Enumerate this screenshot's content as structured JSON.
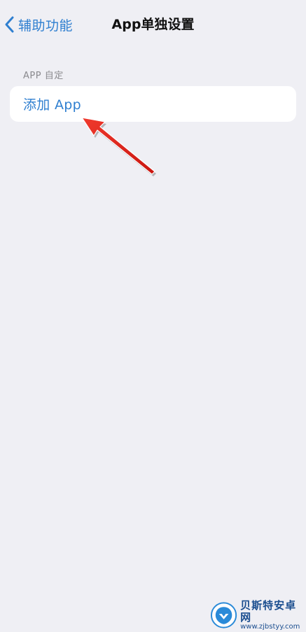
{
  "nav": {
    "back_label": "辅助功能",
    "title": "App单独设置"
  },
  "section": {
    "header": "APP 自定",
    "add_app_label": "添加 App"
  },
  "annotation": {
    "arrow_color": "#e0201b"
  },
  "watermark": {
    "name": "贝斯特安卓网",
    "url": "www.zjbstyy.com"
  },
  "colors": {
    "background": "#efeff4",
    "accent": "#2f7fd0",
    "section_header": "#8a8a8e"
  }
}
